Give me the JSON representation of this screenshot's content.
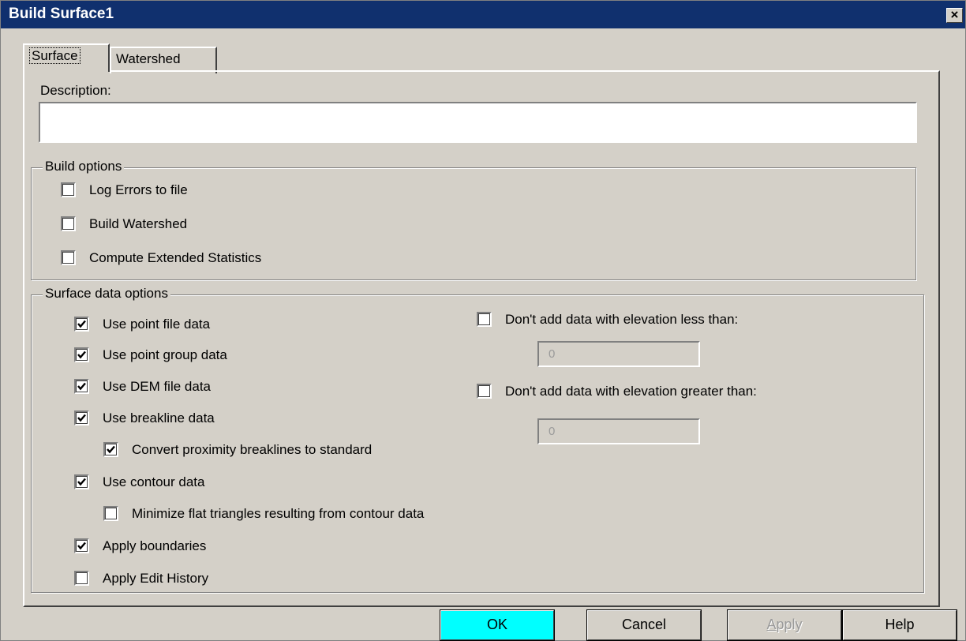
{
  "window": {
    "title": "Build Surface1",
    "close_glyph": "×"
  },
  "tabs": [
    {
      "label": "Surface",
      "active": true
    },
    {
      "label": "Watershed",
      "active": false
    }
  ],
  "description": {
    "label": "Description:",
    "value": ""
  },
  "build_options": {
    "title": "Build options",
    "items": [
      {
        "label": "Log Errors to file",
        "checked": false
      },
      {
        "label": "Build Watershed",
        "checked": false
      },
      {
        "label": "Compute Extended Statistics",
        "checked": false
      }
    ]
  },
  "surface_data_options": {
    "title": "Surface data options",
    "items": [
      {
        "label": "Use point file data",
        "checked": true
      },
      {
        "label": "Use point group data",
        "checked": true
      },
      {
        "label": "Use DEM file data",
        "checked": true
      },
      {
        "label": "Use breakline data",
        "checked": true
      },
      {
        "label": "Convert proximity breaklines to standard",
        "checked": true
      },
      {
        "label": "Use contour data",
        "checked": true
      },
      {
        "label": "Minimize flat triangles resulting from contour data",
        "checked": false
      },
      {
        "label": "Apply boundaries",
        "checked": true
      },
      {
        "label": "Apply Edit History",
        "checked": false
      }
    ],
    "elevation": [
      {
        "label": "Don't add data with elevation less than:",
        "checked": false,
        "value": "0"
      },
      {
        "label": "Don't add data with elevation greater than:",
        "checked": false,
        "value": "0"
      }
    ]
  },
  "buttons": {
    "ok": "OK",
    "cancel": "Cancel",
    "apply_underlined": "A",
    "apply_rest": "pply",
    "help": "Help"
  },
  "colors": {
    "titlebar": "#10306e",
    "dialog_face": "#d4d0c8",
    "ok_button": "#00ffff"
  }
}
